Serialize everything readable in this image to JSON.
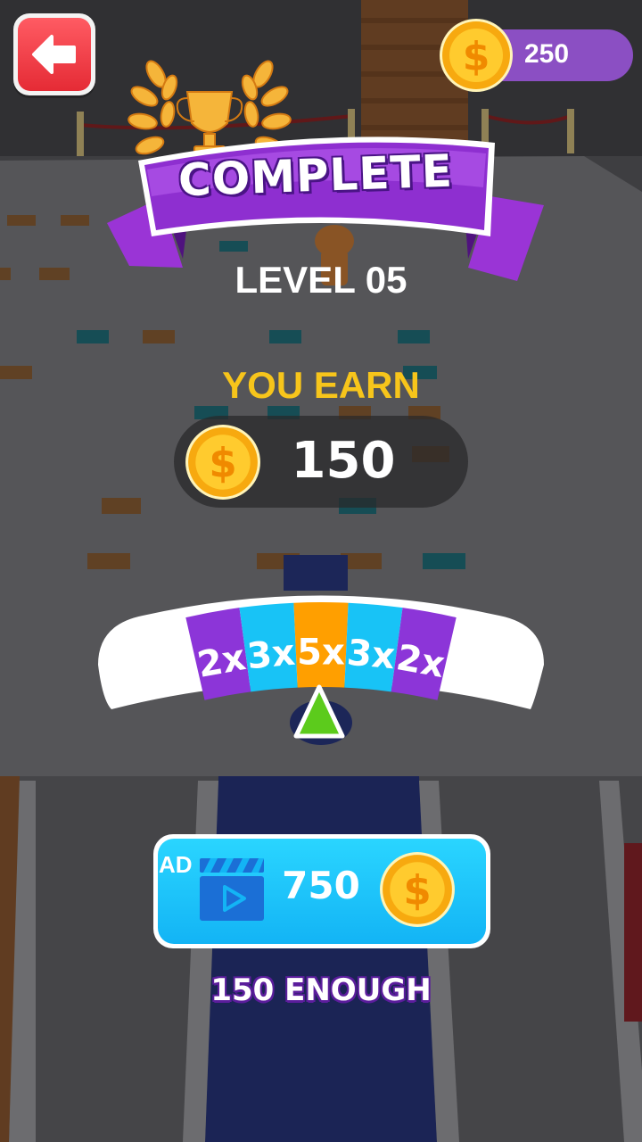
{
  "header": {
    "back_icon": "arrow-left-icon",
    "coin_balance": "250",
    "coin_icon": "dollar-coin-icon"
  },
  "result": {
    "banner": "COMPLETE",
    "level": "LEVEL 05",
    "earn_label": "YOU EARN",
    "earned": "150"
  },
  "multiplier_wheel": {
    "segments": [
      {
        "label": "2x",
        "color": "#8c35d8"
      },
      {
        "label": "3x",
        "color": "#18c3f6"
      },
      {
        "label": "5x",
        "color": "#ff9f00"
      },
      {
        "label": "3x",
        "color": "#18c3f6"
      },
      {
        "label": "2x",
        "color": "#8c35d8"
      }
    ],
    "pointer_color": "#5ccb1c"
  },
  "ad_button": {
    "badge": "AD",
    "reward": "750",
    "icon": "video-clapper-icon"
  },
  "skip_link": "150 ENOUGH",
  "colors": {
    "accent_gold": "#f7c51b",
    "purple": "#8b4fc3",
    "back_red": "#ef3d45"
  }
}
